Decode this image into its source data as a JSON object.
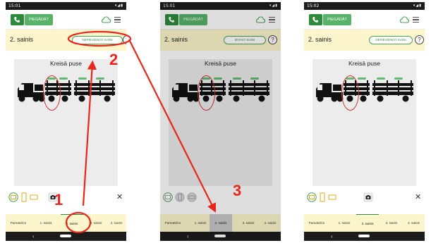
{
  "colors": {
    "accent": "#2e8b3c",
    "arrow": "#e8261b",
    "tab_bar": "#fdf6cc",
    "selected_tab": "#2e8b3c"
  },
  "phones": [
    {
      "status_time": "15:01",
      "status_icons": "▾◢▮",
      "deliver_label": "PIEGĀDĀT",
      "trailer_name": "2. sainis",
      "action_label": "NEPIEVIENOT SAINI",
      "help_label": "?",
      "side_title": "Kreisā puse",
      "close_label": "✕",
      "tabs": [
        "Pamatvilce",
        "1. sainis",
        "2. sainis",
        "3. sainis",
        "4. sainis"
      ],
      "selected_tab": 2,
      "nav_back": "‹",
      "icons": [
        "call-icon",
        "cloud-sync-icon",
        "menu-icon",
        "help-icon",
        "truck-top-view-icon",
        "truck-side-view-icon",
        "trailer-view-icon",
        "camera-icon",
        "close-icon",
        "back-icon",
        "home-icon"
      ]
    },
    {
      "status_time": "15:01",
      "status_icons": "▾◢▮",
      "deliver_label": "PIEGĀDĀT",
      "trailer_name": "2. sainis",
      "action_label": "IEVAKT SAINI",
      "help_label": "?",
      "side_title": "Kreisā puse",
      "close_label": "",
      "tabs": [
        "Pamatvilce",
        "1. sainis",
        "2. sainis",
        "3. sainis",
        "4. sainis"
      ],
      "selected_tab": 2,
      "nav_back": "‹",
      "icons": [
        "call-icon",
        "cloud-sync-icon",
        "menu-icon",
        "help-icon",
        "truck-top-view-icon",
        "truck-side-view-icon",
        "trailer-view-icon",
        "back-icon",
        "home-icon"
      ]
    },
    {
      "status_time": "15:02",
      "status_icons": "▾◢▮",
      "deliver_label": "PIEGĀDĀT",
      "trailer_name": "2. sainis",
      "action_label": "NEPIEVIENOT SAINI",
      "help_label": "?",
      "side_title": "Kreisā puse",
      "close_label": "✕",
      "tabs": [
        "Pamatvilce",
        "1. sainis",
        "2. sainis",
        "3. sainis",
        "4. sainis"
      ],
      "selected_tab": 2,
      "nav_back": "‹",
      "icons": [
        "call-icon",
        "cloud-sync-icon",
        "menu-icon",
        "help-icon",
        "truck-top-view-icon",
        "truck-side-view-icon",
        "trailer-view-icon",
        "camera-icon",
        "close-icon",
        "back-icon",
        "home-icon"
      ]
    }
  ],
  "annotations": {
    "step1": "1",
    "step2": "2",
    "step3": "3"
  }
}
